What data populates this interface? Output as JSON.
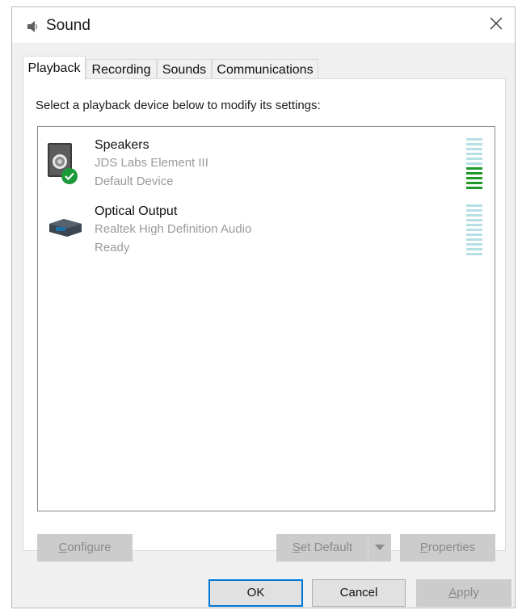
{
  "window": {
    "title": "Sound",
    "icon": "speaker-icon",
    "close_icon": "close-icon"
  },
  "tabs": [
    {
      "label": "Playback",
      "active": true
    },
    {
      "label": "Recording",
      "active": false
    },
    {
      "label": "Sounds",
      "active": false
    },
    {
      "label": "Communications",
      "active": false
    }
  ],
  "playback": {
    "instruction": "Select a playback device below to modify its settings:",
    "devices": [
      {
        "name": "Speakers",
        "driver": "JDS Labs Element III",
        "status": "Default Device",
        "icon": "speaker-device-icon",
        "badge_icon": "default-check-icon",
        "level_segments_lit": 5
      },
      {
        "name": "Optical Output",
        "driver": "Realtek High Definition Audio",
        "status": "Ready",
        "icon": "optical-output-icon",
        "level_segments_lit": 0
      }
    ],
    "buttons": {
      "configure": {
        "accel": "C",
        "rest": "onfigure"
      },
      "set_default": {
        "accel": "S",
        "rest": "et Default"
      },
      "set_default_dropdown_icon": "dropdown-arrow-icon",
      "properties": {
        "accel": "P",
        "rest": "roperties"
      }
    }
  },
  "footer": {
    "ok": "OK",
    "cancel": "Cancel",
    "apply": {
      "accel": "A",
      "rest": "pply"
    }
  },
  "colors": {
    "meter_lit": "#1f9a2a",
    "meter_unlit": "#b6dfe6",
    "default_badge": "#1c9a3a",
    "focus_border": "#0078d7"
  }
}
